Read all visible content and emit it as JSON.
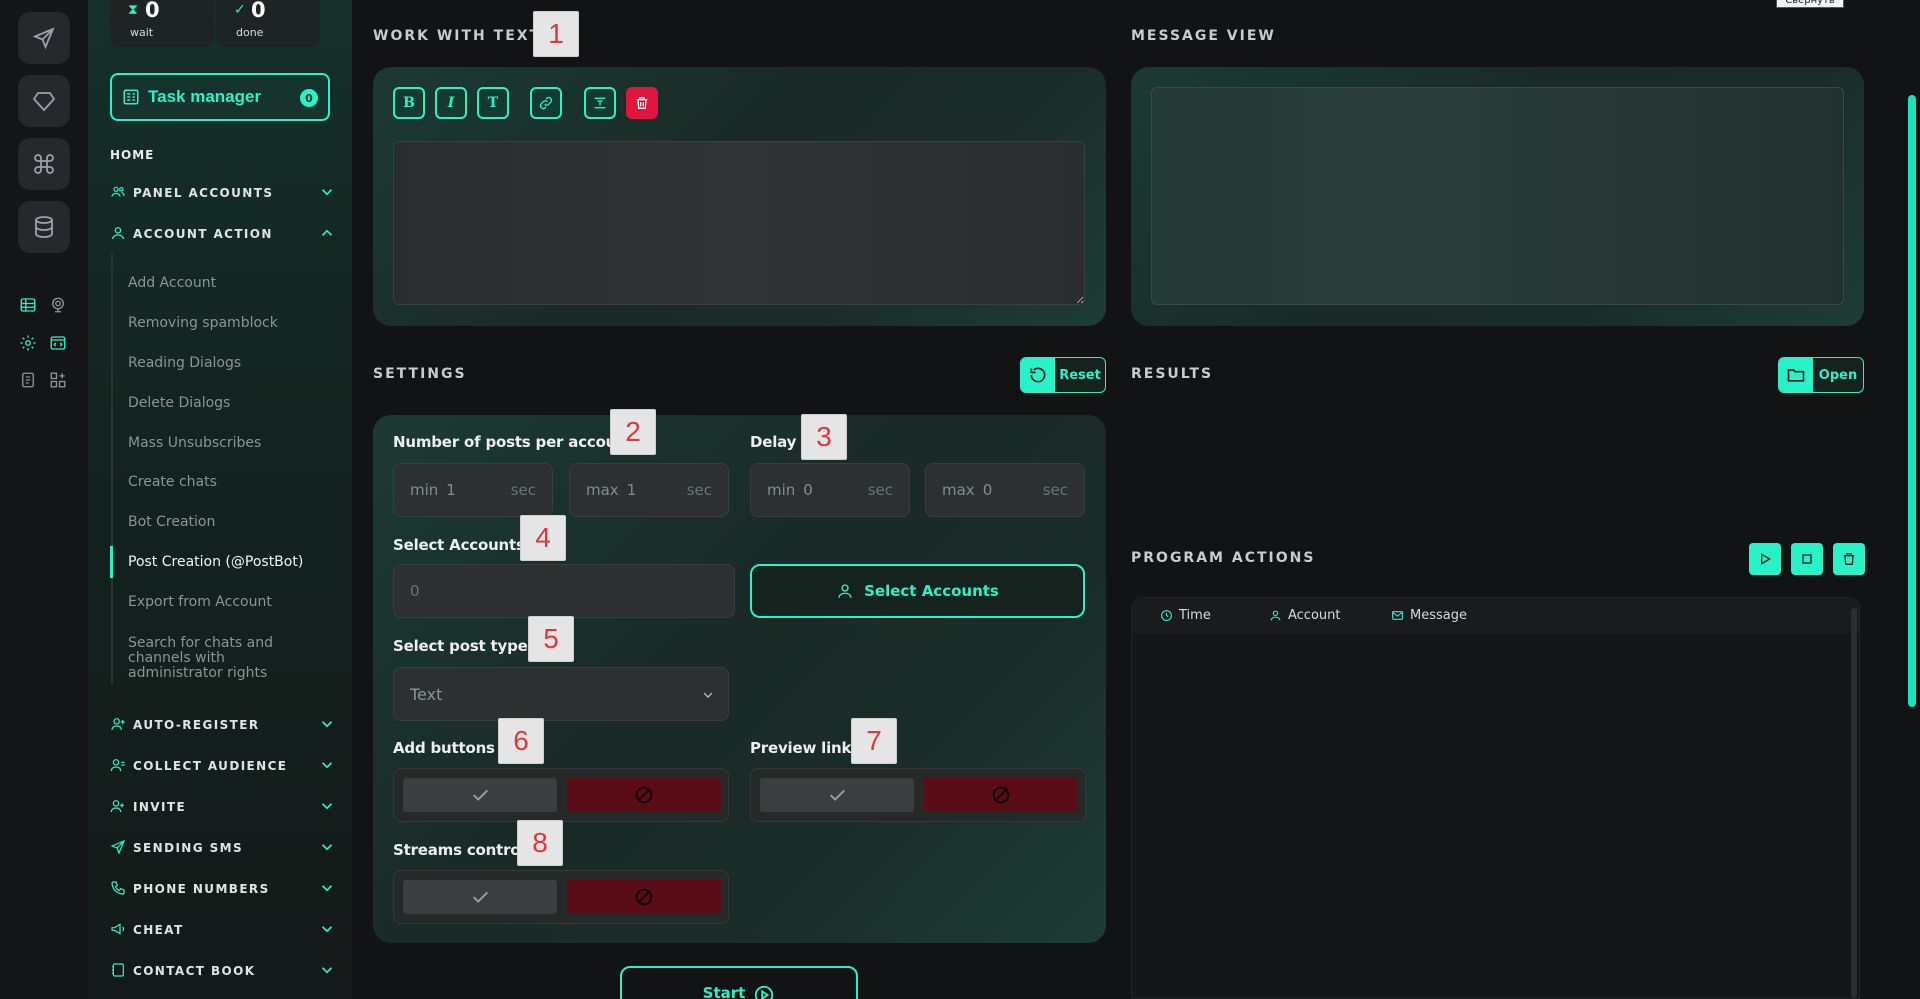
{
  "stats": {
    "wait": {
      "count": "0",
      "label": "wait",
      "icon": "hourglass-icon"
    },
    "done": {
      "count": "0",
      "label": "done",
      "icon": "check-circle-icon"
    }
  },
  "sidebar": {
    "task_manager": {
      "label": "Task manager",
      "badge": "0"
    },
    "home": "HOME",
    "sections": [
      {
        "label": "PANEL ACCOUNTS",
        "icon": "users-icon"
      },
      {
        "label": "ACCOUNT ACTION",
        "icon": "user-icon",
        "expanded": true
      },
      {
        "label": "AUTO-REGISTER",
        "icon": "user-plus-icon"
      },
      {
        "label": "COLLECT AUDIENCE",
        "icon": "user-list-icon"
      },
      {
        "label": "INVITE",
        "icon": "user-add-icon"
      },
      {
        "label": "SENDING SMS",
        "icon": "send-icon"
      },
      {
        "label": "PHONE NUMBERS",
        "icon": "phone-icon"
      },
      {
        "label": "CHEAT",
        "icon": "megaphone-icon"
      },
      {
        "label": "CONTACT BOOK",
        "icon": "book-icon"
      }
    ],
    "sub_items": [
      "Add Account",
      "Removing spamblock",
      "Reading Dialogs",
      "Delete Dialogs",
      "Mass Unsubscribes",
      "Create chats",
      "Bot Creation",
      "Post Creation (@PostBot)",
      "Export from Account",
      "Search for chats and channels with administrator rights"
    ],
    "active_sub_item": "Post Creation (@PostBot)"
  },
  "work_with_text": {
    "title": "WORK WITH TEXT",
    "tools": [
      {
        "name": "bold",
        "glyph": "B"
      },
      {
        "name": "italic",
        "glyph": "I"
      },
      {
        "name": "text",
        "glyph": "T"
      }
    ],
    "editor_value": ""
  },
  "message_view": {
    "title": "MESSAGE VIEW"
  },
  "settings": {
    "title": "SETTINGS",
    "reset_label": "Reset",
    "posts_per_account": {
      "label": "Number of posts per account",
      "min_prefix": "min",
      "min_value": "1",
      "max_prefix": "max",
      "max_value": "1",
      "unit": "sec"
    },
    "delay": {
      "label": "Delay",
      "min_prefix": "min",
      "min_value": "0",
      "max_prefix": "max",
      "max_value": "0",
      "unit": "sec"
    },
    "select_accounts": {
      "label": "Select Accounts",
      "value": "0",
      "button_label": "Select Accounts"
    },
    "post_type": {
      "label": "Select post type:",
      "value": "Text"
    },
    "add_buttons": {
      "label": "Add buttons"
    },
    "preview_links": {
      "label": "Preview links"
    },
    "streams_control": {
      "label": "Streams control"
    },
    "start_label": "Start"
  },
  "results": {
    "title": "RESULTS",
    "open_label": "Open"
  },
  "program_actions": {
    "title": "PROGRAM ACTIONS",
    "columns": [
      "Time",
      "Account",
      "Message"
    ]
  },
  "markers": [
    "1",
    "2",
    "3",
    "4",
    "5",
    "6",
    "7",
    "8"
  ],
  "tooltip": "Свернуть",
  "colors": {
    "accent": "#29f2c9",
    "danger": "#e0153c",
    "deny": "#5a0c17"
  }
}
